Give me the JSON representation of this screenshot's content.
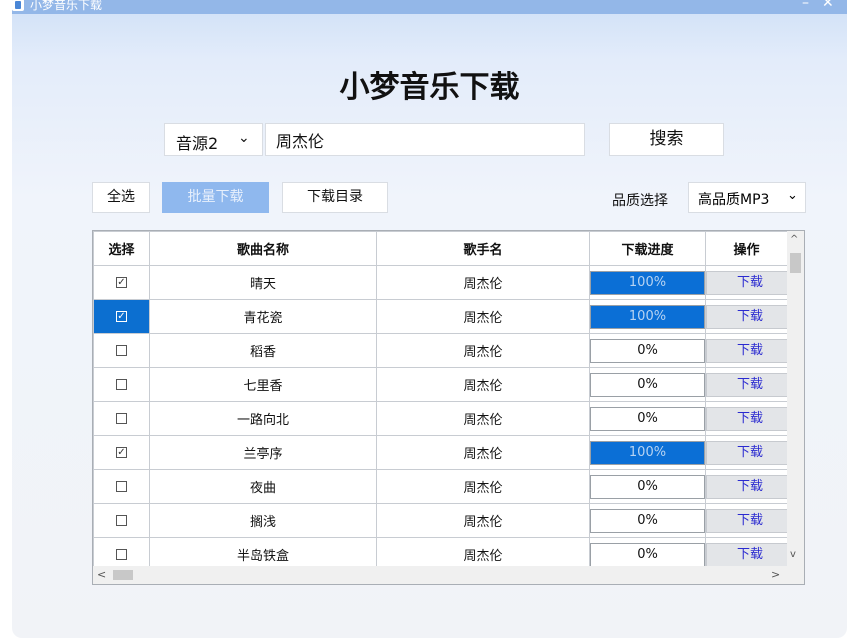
{
  "window": {
    "title": "小梦音乐下载",
    "minimize_icon": "minimize-icon",
    "close_icon": "close-icon"
  },
  "app_title": "小梦音乐下载",
  "search": {
    "source_selected": "音源2",
    "query": "周杰伦",
    "button_label": "搜索"
  },
  "toolbar": {
    "select_all_label": "全选",
    "batch_download_label": "批量下载",
    "download_dir_label": "下载目录",
    "quality_label": "品质选择",
    "quality_selected": "高品质MP3"
  },
  "table": {
    "headers": [
      "选择",
      "歌曲名称",
      "歌手名",
      "下载进度",
      "操作"
    ],
    "rows": [
      {
        "checked": true,
        "selected": false,
        "song": "晴天",
        "artist": "周杰伦",
        "progress_text": "100%",
        "progress": 100,
        "action": "下载"
      },
      {
        "checked": true,
        "selected": true,
        "song": "青花瓷",
        "artist": "周杰伦",
        "progress_text": "100%",
        "progress": 100,
        "action": "下载"
      },
      {
        "checked": false,
        "selected": false,
        "song": "稻香",
        "artist": "周杰伦",
        "progress_text": "0%",
        "progress": 0,
        "action": "下载"
      },
      {
        "checked": false,
        "selected": false,
        "song": "七里香",
        "artist": "周杰伦",
        "progress_text": "0%",
        "progress": 0,
        "action": "下载"
      },
      {
        "checked": false,
        "selected": false,
        "song": "一路向北",
        "artist": "周杰伦",
        "progress_text": "0%",
        "progress": 0,
        "action": "下载"
      },
      {
        "checked": true,
        "selected": false,
        "song": "兰亭序",
        "artist": "周杰伦",
        "progress_text": "100%",
        "progress": 100,
        "action": "下载"
      },
      {
        "checked": false,
        "selected": false,
        "song": "夜曲",
        "artist": "周杰伦",
        "progress_text": "0%",
        "progress": 0,
        "action": "下载"
      },
      {
        "checked": false,
        "selected": false,
        "song": "搁浅",
        "artist": "周杰伦",
        "progress_text": "0%",
        "progress": 0,
        "action": "下载"
      },
      {
        "checked": false,
        "selected": false,
        "song": "半岛铁盒",
        "artist": "周杰伦",
        "progress_text": "0%",
        "progress": 0,
        "action": "下载"
      }
    ]
  },
  "colors": {
    "accent": "#0b6fd6",
    "primary_button": "#8fb8ee",
    "download_link": "#2a2ad0"
  }
}
